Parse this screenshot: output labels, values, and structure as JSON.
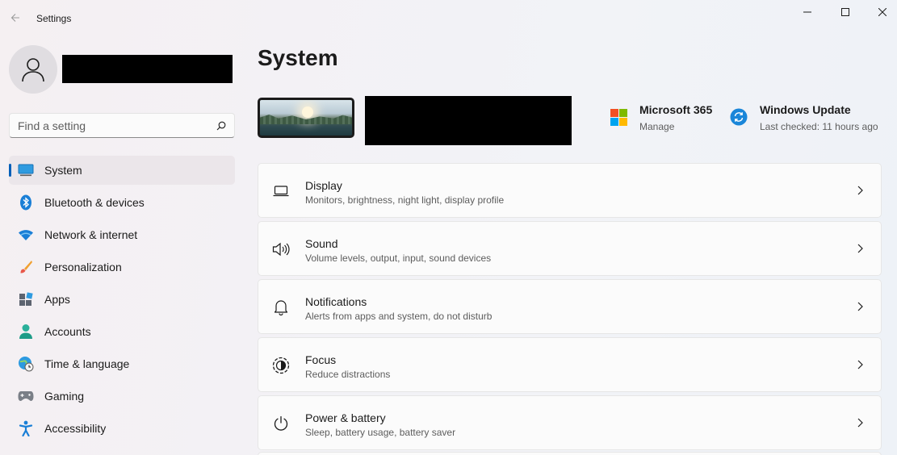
{
  "window": {
    "title": "Settings",
    "icons": {
      "back": "back-arrow-icon",
      "minimize": "minimize-icon",
      "maximize": "maximize-icon",
      "close": "close-icon"
    }
  },
  "sidebar": {
    "search_placeholder": "Find a setting",
    "items": [
      {
        "label": "System",
        "icon": "system-icon",
        "active": true
      },
      {
        "label": "Bluetooth & devices",
        "icon": "bluetooth-icon",
        "active": false
      },
      {
        "label": "Network & internet",
        "icon": "wifi-icon",
        "active": false
      },
      {
        "label": "Personalization",
        "icon": "brush-icon",
        "active": false
      },
      {
        "label": "Apps",
        "icon": "apps-icon",
        "active": false
      },
      {
        "label": "Accounts",
        "icon": "accounts-icon",
        "active": false
      },
      {
        "label": "Time & language",
        "icon": "globe-clock-icon",
        "active": false
      },
      {
        "label": "Gaming",
        "icon": "gamepad-icon",
        "active": false
      },
      {
        "label": "Accessibility",
        "icon": "accessibility-icon",
        "active": false
      }
    ]
  },
  "main": {
    "title": "System",
    "microsoft365": {
      "title": "Microsoft 365",
      "subtitle": "Manage"
    },
    "windows_update": {
      "title": "Windows Update",
      "subtitle": "Last checked: 11 hours ago"
    },
    "cards": [
      {
        "title": "Display",
        "subtitle": "Monitors, brightness, night light, display profile",
        "icon": "display-icon"
      },
      {
        "title": "Sound",
        "subtitle": "Volume levels, output, input, sound devices",
        "icon": "speaker-icon"
      },
      {
        "title": "Notifications",
        "subtitle": "Alerts from apps and system, do not disturb",
        "icon": "bell-icon"
      },
      {
        "title": "Focus",
        "subtitle": "Reduce distractions",
        "icon": "focus-icon"
      },
      {
        "title": "Power & battery",
        "subtitle": "Sleep, battery usage, battery saver",
        "icon": "power-icon"
      }
    ]
  },
  "colors": {
    "accent": "#005fb8",
    "ms_red": "#f25022",
    "ms_green": "#7fba00",
    "ms_blue": "#00a4ef",
    "ms_yellow": "#ffb900",
    "update_blue": "#1a86d9"
  }
}
